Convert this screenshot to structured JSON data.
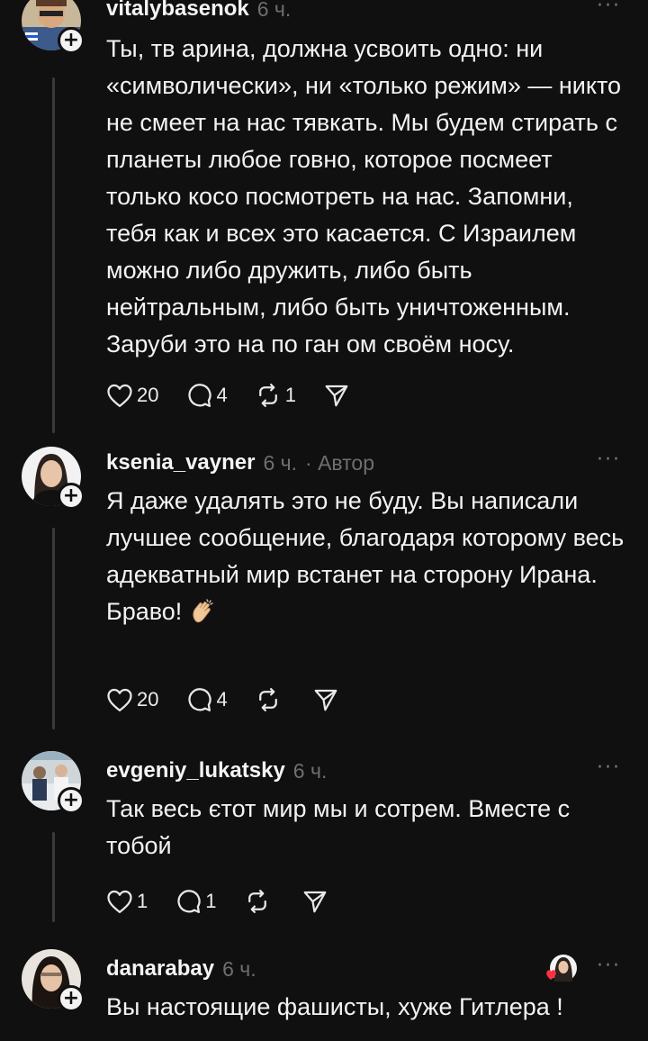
{
  "posts": [
    {
      "username": "vitalybasenok",
      "time": "6 ч.",
      "author": "",
      "more": "···",
      "text": [
        "Ты, тв арина, должна усвоить одно: ни «символически», ни «только режим» — никто не смеет на нас тявкать. Мы будем стирать с планеты любое говно, которое посмеет только косо посмотреть на нас. Запомни, тебя как и всех это касается. С Израилем можно либо дружить, либо быть нейтральным, либо быть уничтоженным. Заруби это на по ган ом своём носу."
      ],
      "likes": "20",
      "replies": "4",
      "reposts": "1"
    },
    {
      "username": "ksenia_vayner",
      "time": "6 ч.",
      "author": "· Автор",
      "more": "···",
      "text": [
        "Я даже удалять это не буду. Вы написали лучшее сообщение, благодаря которому весь адекватный мир встанет на сторону Ирана.",
        "Браво!"
      ],
      "likes": "20",
      "replies": "4",
      "reposts": ""
    },
    {
      "username": "evgeniy_lukatsky",
      "time": "6 ч.",
      "author": "",
      "more": "···",
      "text": [
        "Так весь єтот мир мы и сотрем. Вместе с тобой"
      ],
      "likes": "1",
      "replies": "1",
      "reposts": ""
    },
    {
      "username": "danarabay",
      "time": "6 ч.",
      "author": "",
      "more": "···",
      "text": [
        "Вы настоящие фашисты, хуже Гитлера !"
      ],
      "likes": "",
      "replies": "",
      "reposts": ""
    }
  ],
  "icons": {
    "like": "heart-icon",
    "reply": "comment-icon",
    "repost": "repost-icon",
    "share": "send-icon",
    "follow": "plus-icon",
    "clap": "clapping-hands-emoji"
  },
  "colors": {
    "background": "#101010",
    "text": "#f3f3f3",
    "muted": "#6f6f6f",
    "thread": "#3a3a3a",
    "liked_heart": "#ff3040"
  }
}
